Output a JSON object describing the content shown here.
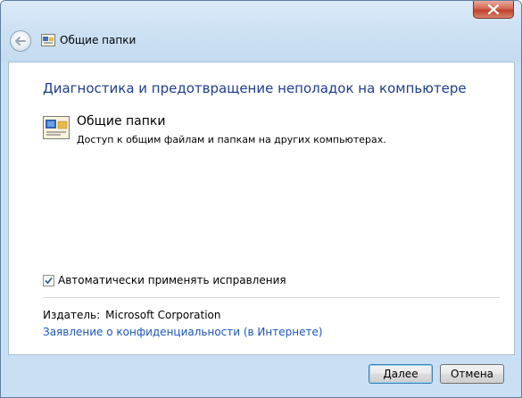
{
  "window": {
    "title": "Общие папки"
  },
  "content": {
    "heading": "Диагностика и предотвращение неполадок на компьютере",
    "item": {
      "title": "Общие папки",
      "description": "Доступ к общим файлам и папкам на других компьютерах.",
      "icon": "shared-folder-icon"
    },
    "auto_apply": {
      "label": "Автоматически применять исправления",
      "checked": true
    },
    "publisher": {
      "label": "Издатель:",
      "value": "Microsoft Corporation"
    },
    "privacy_link": "Заявление о конфиденциальности (в Интернете)"
  },
  "buttons": {
    "next": "Далее",
    "cancel": "Отмена"
  }
}
